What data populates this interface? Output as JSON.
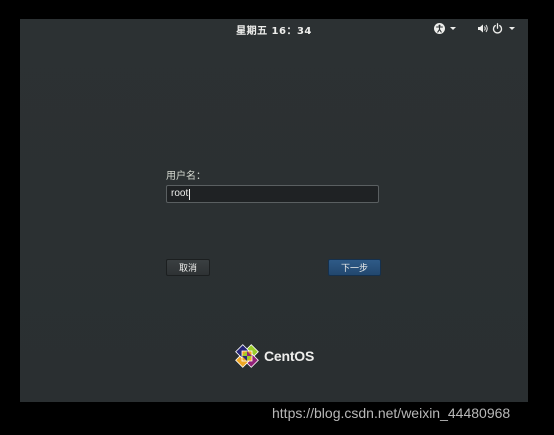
{
  "topbar": {
    "clock": "星期五 16：34",
    "accessibility_icon": "accessibility-icon",
    "volume_icon": "volume-icon",
    "power_icon": "power-icon"
  },
  "login": {
    "username_label": "用户名：",
    "username_value": "root",
    "cancel_label": "取消",
    "next_label": "下一步"
  },
  "brand": {
    "name": "CentOS",
    "logo_icon": "centos-logo-icon"
  },
  "watermark": "https://blog.csdn.net/weixin_44480968",
  "colors": {
    "background": "#2b3032",
    "next_button": "#2a5280",
    "text": "#eeeeec"
  }
}
